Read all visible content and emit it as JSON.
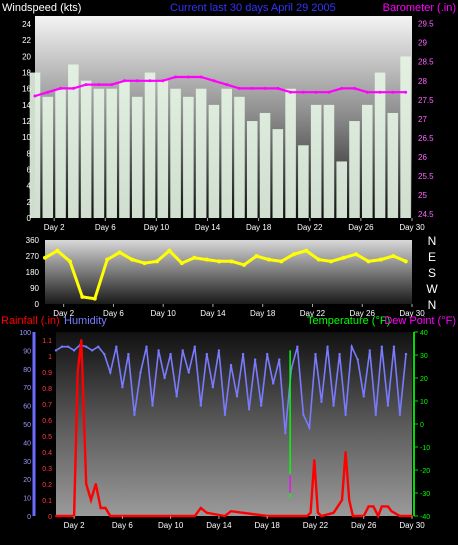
{
  "header": {
    "wind_title": "Windspeed (kts)",
    "center_title": "Current last 30 days April 29 2005",
    "baro_title": "Barometer (.in)"
  },
  "colors": {
    "wind": "#e6f5e6",
    "baro": "#ff00ff",
    "dir": "#ffff00",
    "rain": "#ff0000",
    "humidity": "#7a7aff",
    "temp": "#00ff00",
    "dew": "#ff00ff",
    "axis_left": "#6b6bff",
    "axis_right": "#00dd00"
  },
  "x_labels": [
    "Day 2",
    "Day 6",
    "Day 10",
    "Day 14",
    "Day 18",
    "Day 22",
    "Day 26",
    "Day 30"
  ],
  "bottom_header": {
    "rain_label": "Rainfall (.in)",
    "humidity_label": "Humidity",
    "temp_label": "Temperature (°F)",
    "dew_label": "Dew Point (°F)"
  },
  "chart_data": [
    {
      "type": "area",
      "title": "Current last 30 days April 29 2005",
      "xlabel": "",
      "ylabel": "Windspeed (kts)",
      "y2label": "Barometer (.in)",
      "x_range": [
        0.5,
        30
      ],
      "ylim": [
        0,
        25
      ],
      "y2lim": [
        24.4,
        29.7
      ],
      "yticks": [
        0,
        2,
        4,
        6,
        8,
        10,
        12,
        14,
        16,
        18,
        20,
        22,
        24
      ],
      "y2ticks": [
        "24.5",
        "25",
        "25.5",
        "26",
        "26.5",
        "27",
        "27.5",
        "28",
        "28.5",
        "29",
        "29.5"
      ],
      "series": [
        {
          "name": "Windspeed (kts)",
          "x": [
            0.5,
            1.5,
            2.5,
            3.5,
            4.5,
            5.5,
            6.5,
            7.5,
            8.5,
            9.5,
            10.5,
            11.5,
            12.5,
            13.5,
            14.5,
            15.5,
            16.5,
            17.5,
            18.5,
            19.5,
            20.5,
            21.5,
            22.5,
            23.5,
            24.5,
            25.5,
            26.5,
            27.5,
            28.5,
            29.5
          ],
          "values": [
            18,
            15,
            16,
            19,
            17,
            16,
            16,
            17,
            15,
            18,
            17,
            16,
            15,
            16,
            14,
            16,
            15,
            12,
            13,
            11,
            16,
            9,
            14,
            14,
            7,
            12,
            14,
            18,
            13,
            20
          ]
        },
        {
          "name": "Barometer (.in)",
          "x": [
            0.5,
            1.5,
            2.5,
            3.5,
            4.5,
            5.5,
            6.5,
            7.5,
            8.5,
            9.5,
            10.5,
            11.5,
            12.5,
            13.5,
            14.5,
            15.5,
            16.5,
            17.5,
            18.5,
            19.5,
            20.5,
            21.5,
            22.5,
            23.5,
            24.5,
            25.5,
            26.5,
            27.5,
            28.5,
            29.5
          ],
          "values": [
            27.6,
            27.7,
            27.8,
            27.8,
            27.9,
            27.9,
            27.9,
            28.0,
            28.0,
            28.0,
            28.0,
            28.1,
            28.1,
            28.1,
            28.0,
            27.9,
            27.8,
            27.8,
            27.8,
            27.8,
            27.7,
            27.7,
            27.7,
            27.7,
            27.8,
            27.8,
            27.7,
            27.7,
            27.7,
            27.7
          ]
        }
      ]
    },
    {
      "type": "area",
      "ylabel": "",
      "ylim": [
        0,
        360
      ],
      "yticks": [
        0,
        90,
        180,
        270,
        360
      ],
      "direction_labels": [
        "N",
        "W",
        "S",
        "E",
        "N"
      ],
      "series": [
        {
          "name": "Wind direction",
          "x": [
            0.5,
            1.5,
            2.5,
            3.5,
            4.5,
            5.5,
            6.5,
            7.5,
            8.5,
            9.5,
            10.5,
            11.5,
            12.5,
            13.5,
            14.5,
            15.5,
            16.5,
            17.5,
            18.5,
            19.5,
            20.5,
            21.5,
            22.5,
            23.5,
            24.5,
            25.5,
            26.5,
            27.5,
            28.5,
            29.5
          ],
          "values": [
            260,
            300,
            240,
            40,
            30,
            250,
            290,
            250,
            230,
            240,
            300,
            230,
            260,
            250,
            240,
            240,
            220,
            270,
            250,
            240,
            280,
            300,
            250,
            240,
            260,
            280,
            240,
            250,
            270,
            240
          ]
        }
      ]
    },
    {
      "type": "line",
      "xlabel": "",
      "ylabel": "Rainfall (.in)",
      "ylim": [
        0,
        1.15
      ],
      "yticks": [
        0,
        0.1,
        0.2,
        0.3,
        0.4,
        0.5,
        0.6,
        0.7,
        0.8,
        0.9,
        1,
        1.1
      ],
      "humidity_ticks": [
        0,
        10,
        20,
        30,
        40,
        50,
        60,
        70,
        80,
        90,
        100
      ],
      "y2lim": [
        -40,
        40
      ],
      "y2ticks": [
        -40,
        -30,
        -20,
        -10,
        0,
        10,
        20,
        30,
        40
      ],
      "series": [
        {
          "name": "Rainfall (.in)",
          "x": [
            0.5,
            2.0,
            2.3,
            2.6,
            3.0,
            3.4,
            3.8,
            4.2,
            4.6,
            5.0,
            6.0,
            8.0,
            10.0,
            12.0,
            12.5,
            13.0,
            14.5,
            15.0,
            16.0,
            18.0,
            20.0,
            21.3,
            21.6,
            21.9,
            22.2,
            22.5,
            23.5,
            24.2,
            24.5,
            24.8,
            25.1,
            25.5,
            26.0,
            26.4,
            26.8,
            27.2,
            27.5,
            28.0,
            28.3,
            29.0,
            30.0
          ],
          "values": [
            0,
            0,
            0.9,
            1.1,
            0.2,
            0.1,
            0.2,
            0.05,
            0.05,
            0,
            0,
            0,
            0,
            0,
            0.05,
            0.02,
            0,
            0.03,
            0.02,
            0,
            0,
            0,
            0.02,
            0.35,
            0.02,
            0,
            0.02,
            0.1,
            0.4,
            0.1,
            0,
            0,
            0,
            0.06,
            0.06,
            0,
            0.06,
            0.06,
            0.03,
            0,
            0
          ]
        },
        {
          "name": "Humidity",
          "x": [
            0.5,
            1.0,
            1.5,
            2.0,
            2.5,
            3.0,
            3.5,
            4.0,
            4.5,
            5.0,
            5.5,
            6.0,
            6.5,
            7.0,
            7.5,
            8.0,
            8.5,
            9.0,
            9.5,
            10.0,
            10.5,
            11.0,
            11.5,
            12.0,
            12.5,
            13.0,
            13.5,
            14.0,
            14.5,
            15.0,
            15.5,
            16.0,
            16.5,
            17.0,
            17.5,
            18.0,
            18.5,
            19.0,
            19.5,
            20.0,
            20.5,
            21.0,
            21.5,
            22.0,
            22.5,
            23.0,
            23.5,
            24.0,
            24.5,
            25.0,
            25.5,
            26.0,
            26.5,
            27.0,
            27.5,
            28.0,
            28.5,
            29.0,
            29.5
          ],
          "values": [
            90,
            92,
            92,
            90,
            93,
            92,
            90,
            92,
            88,
            78,
            92,
            70,
            88,
            55,
            78,
            92,
            60,
            90,
            75,
            88,
            65,
            90,
            78,
            92,
            60,
            88,
            70,
            90,
            55,
            82,
            65,
            88,
            58,
            85,
            60,
            88,
            72,
            85,
            45,
            80,
            92,
            55,
            48,
            88,
            62,
            92,
            60,
            88,
            55,
            92,
            85,
            65,
            90,
            55,
            92,
            60,
            92,
            55,
            88
          ]
        },
        {
          "name": "Temperature (°F)",
          "x": [
            19.9,
            19.9
          ],
          "values": [
            32,
            -32
          ]
        },
        {
          "name": "Dew Point (°F)",
          "x": [
            19.9,
            19.9
          ],
          "values": [
            -22,
            -30
          ]
        }
      ]
    }
  ]
}
